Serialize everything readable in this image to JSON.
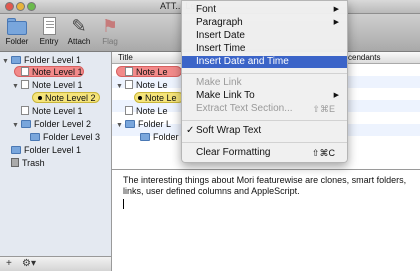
{
  "window": {
    "title": "ATT... Level 1"
  },
  "toolbar": {
    "items": [
      {
        "label": "Folder",
        "icon": "folder-icon"
      },
      {
        "label": "Entry",
        "icon": "entry-icon"
      },
      {
        "label": "Attach",
        "icon": "paperclip-icon"
      },
      {
        "label": "Flag",
        "icon": "flag-icon"
      }
    ]
  },
  "sidebar": {
    "items": [
      {
        "label": "Folder Level 1"
      },
      {
        "label": "Note Level 1"
      },
      {
        "label": "Note Level 1"
      },
      {
        "label": "Note Level 2"
      },
      {
        "label": "Note Level 1"
      },
      {
        "label": "Folder Level 2"
      },
      {
        "label": "Folder Level 3"
      },
      {
        "label": "Folder Level 1"
      },
      {
        "label": "Trash"
      }
    ],
    "footer": {
      "add": "+",
      "action": "⚙▾"
    }
  },
  "outline": {
    "columns": {
      "title": "Title",
      "descendants": "scendants"
    },
    "rows": [
      {
        "label": "Note Le"
      },
      {
        "label": "Note Le"
      },
      {
        "label": "Note Le"
      },
      {
        "label": "Note Le"
      },
      {
        "label": "Folder L"
      },
      {
        "label": "Folder"
      }
    ]
  },
  "editor": {
    "text": "The interesting things about Mori featurewise are clones, smart folders, links, user defined columns and AppleScript."
  },
  "context_menu": {
    "items": [
      {
        "label": "Font",
        "submenu": "▶"
      },
      {
        "label": "Paragraph",
        "submenu": "▶"
      },
      {
        "label": "Insert Date"
      },
      {
        "label": "Insert Time"
      },
      {
        "label": "Insert Date and Time"
      },
      {
        "label": "Make Link"
      },
      {
        "label": "Make Link To",
        "submenu": "▶"
      },
      {
        "label": "Extract Text Section...",
        "shortcut": "⇧⌘E"
      },
      {
        "label": "Soft Wrap Text",
        "check": "✓"
      },
      {
        "label": "Clear Formatting",
        "shortcut": "⇧⌘C"
      }
    ]
  }
}
